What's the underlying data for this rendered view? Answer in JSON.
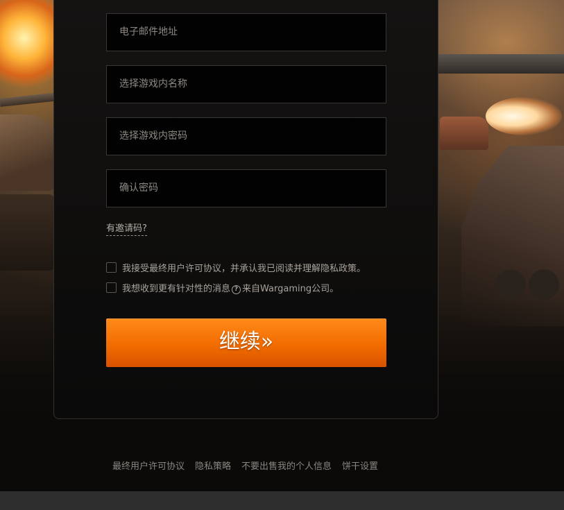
{
  "form": {
    "email_placeholder": "电子邮件地址",
    "game_name_placeholder": "选择游戏内名称",
    "game_password_placeholder": "选择游戏内密码",
    "confirm_password_placeholder": "确认密码",
    "invite_code_link": "有邀请码?",
    "eula_checkbox": {
      "label": "我接受最终用户许可协议，并承认我已阅读并理解隐私政策。",
      "checked": false
    },
    "marketing_checkbox": {
      "label_before": "我想收到更有针对性的消息",
      "help_icon_glyph": "?",
      "label_after": "来自Wargaming公司。",
      "checked": false
    },
    "continue_button": "继续»"
  },
  "footer": {
    "links": [
      "最终用户许可协议",
      "隐私策略",
      "不要出售我的个人信息",
      "饼干设置"
    ]
  },
  "colors": {
    "accent": "#f26c00",
    "panel_bg": "#0f0e0d",
    "field_bg": "#020202",
    "bottom_bar": "#2e2e2e"
  },
  "icons": [
    "help-icon"
  ]
}
